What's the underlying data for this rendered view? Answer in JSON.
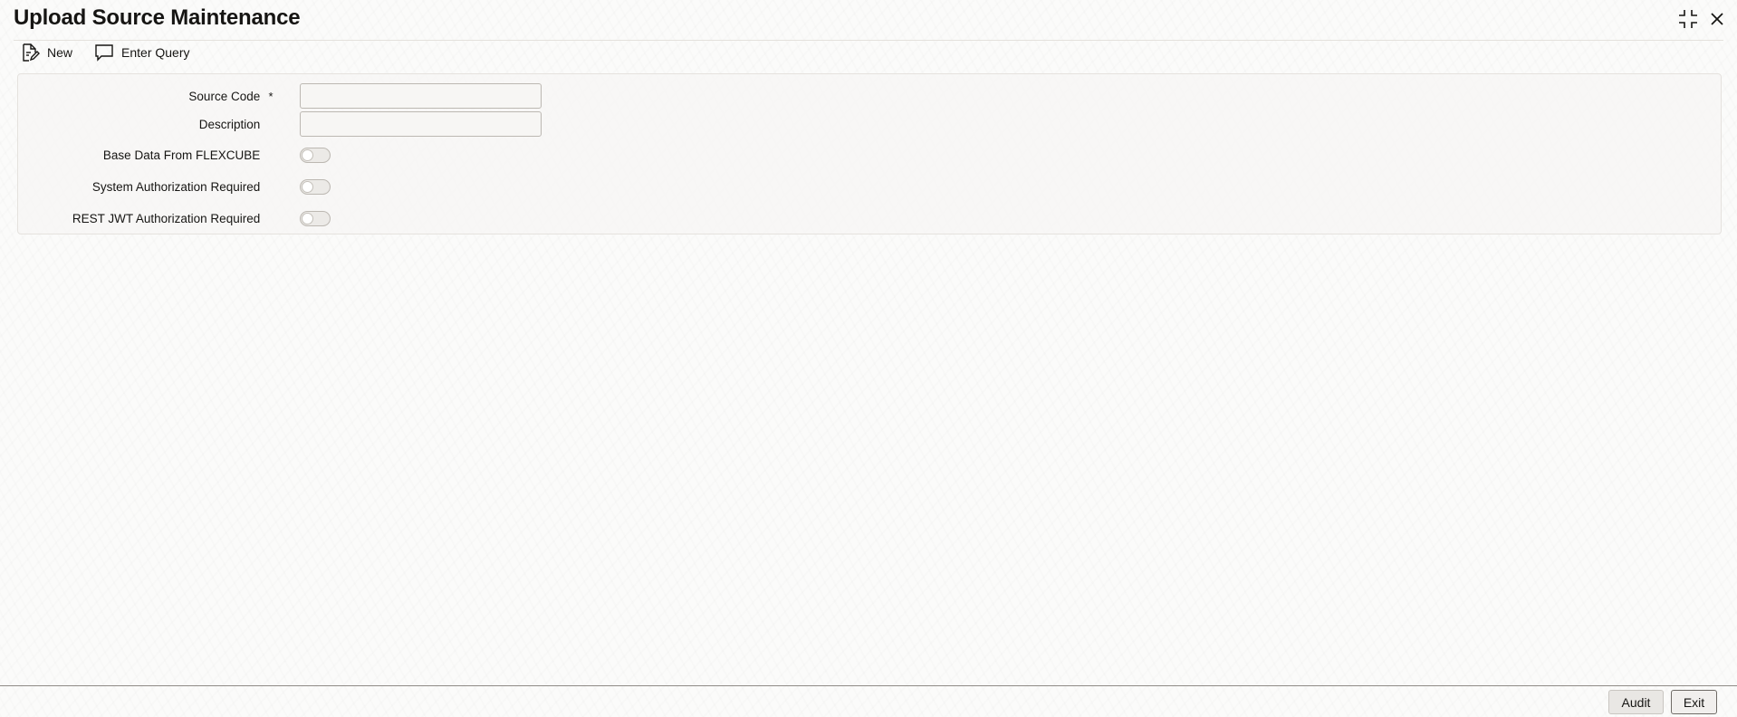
{
  "window": {
    "title": "Upload Source Maintenance",
    "controls": [
      {
        "icon": "collapse-icon"
      },
      {
        "icon": "close-icon"
      }
    ]
  },
  "toolbar": {
    "new_label": "New",
    "enter_query_label": "Enter Query"
  },
  "form": {
    "source_code": {
      "label": "Source Code",
      "required_marker": "*",
      "value": ""
    },
    "description": {
      "label": "Description",
      "value": ""
    },
    "base_data_from_flexcube": {
      "label": "Base Data From FLEXCUBE",
      "checked": false
    },
    "system_authorization_required": {
      "label": "System Authorization Required",
      "checked": false
    },
    "rest_jwt_authorization_required": {
      "label": "REST JWT Authorization Required",
      "checked": false
    }
  },
  "footer": {
    "audit_label": "Audit",
    "exit_label": "Exit"
  },
  "colors": {
    "text": "#161513",
    "background": "#fbfbfa",
    "panel": "#f7f6f4",
    "border": "#bcb8b2"
  }
}
